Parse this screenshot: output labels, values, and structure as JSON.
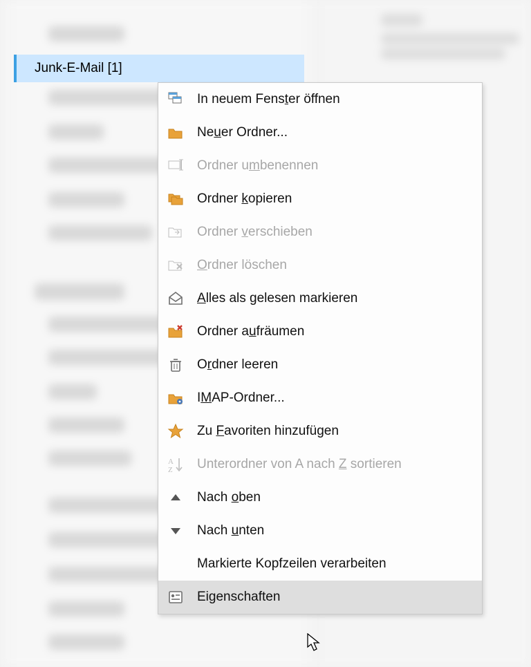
{
  "selected_folder": {
    "label": "Junk-E-Mail [1]"
  },
  "menu": {
    "items": [
      {
        "id": "open-new-window",
        "label": "In neuem Fenster öffnen",
        "uidx": 13,
        "enabled": true,
        "icon": "windows"
      },
      {
        "id": "new-folder",
        "label": "Neuer Ordner...",
        "uidx": 2,
        "enabled": true,
        "icon": "folder"
      },
      {
        "id": "rename-folder",
        "label": "Ordner umbenennen",
        "uidx": 8,
        "enabled": false,
        "icon": "rename"
      },
      {
        "id": "copy-folder",
        "label": "Ordner kopieren",
        "uidx": 7,
        "enabled": true,
        "icon": "folder-copy"
      },
      {
        "id": "move-folder",
        "label": "Ordner verschieben",
        "uidx": 7,
        "enabled": false,
        "icon": "folder-move"
      },
      {
        "id": "delete-folder",
        "label": "Ordner löschen",
        "uidx": 0,
        "enabled": false,
        "icon": "folder-delete"
      },
      {
        "id": "mark-all-read",
        "label": "Alles als gelesen markieren",
        "uidx": 0,
        "enabled": true,
        "icon": "envelope-open"
      },
      {
        "id": "cleanup-folder",
        "label": "Ordner aufräumen",
        "uidx": 8,
        "enabled": true,
        "icon": "cleanup"
      },
      {
        "id": "empty-folder",
        "label": "Ordner leeren",
        "uidx": 1,
        "enabled": true,
        "icon": "trash"
      },
      {
        "id": "imap-folders",
        "label": "IMAP-Ordner...",
        "uidx": 1,
        "enabled": true,
        "icon": "folder-gear"
      },
      {
        "id": "add-favorite",
        "label": "Zu Favoriten hinzufügen",
        "uidx": 3,
        "enabled": true,
        "icon": "star"
      },
      {
        "id": "sort-subfolders",
        "label": "Unterordner von A nach Z sortieren",
        "uidx": 23,
        "enabled": false,
        "icon": "sort-az"
      },
      {
        "id": "move-up",
        "label": "Nach oben",
        "uidx": 5,
        "enabled": true,
        "icon": "tri-up"
      },
      {
        "id": "move-down",
        "label": "Nach unten",
        "uidx": 5,
        "enabled": true,
        "icon": "tri-down"
      },
      {
        "id": "process-headers",
        "label": "Markierte Kopfzeilen verarbeiten",
        "uidx": -1,
        "enabled": true,
        "icon": "none"
      },
      {
        "id": "properties",
        "label": "Eigenschaften",
        "uidx": -1,
        "enabled": true,
        "icon": "properties",
        "hover": true
      }
    ]
  },
  "colors": {
    "selection_bg": "#cde7ff",
    "selection_border": "#3da0e3",
    "menu_bg": "#fdfdfd",
    "menu_border": "#c9c9c9",
    "hover_bg": "#dedede",
    "disabled_text": "#a7a7a7",
    "icon_orange": "#e8a23a",
    "icon_gray": "#7a7a7a"
  }
}
